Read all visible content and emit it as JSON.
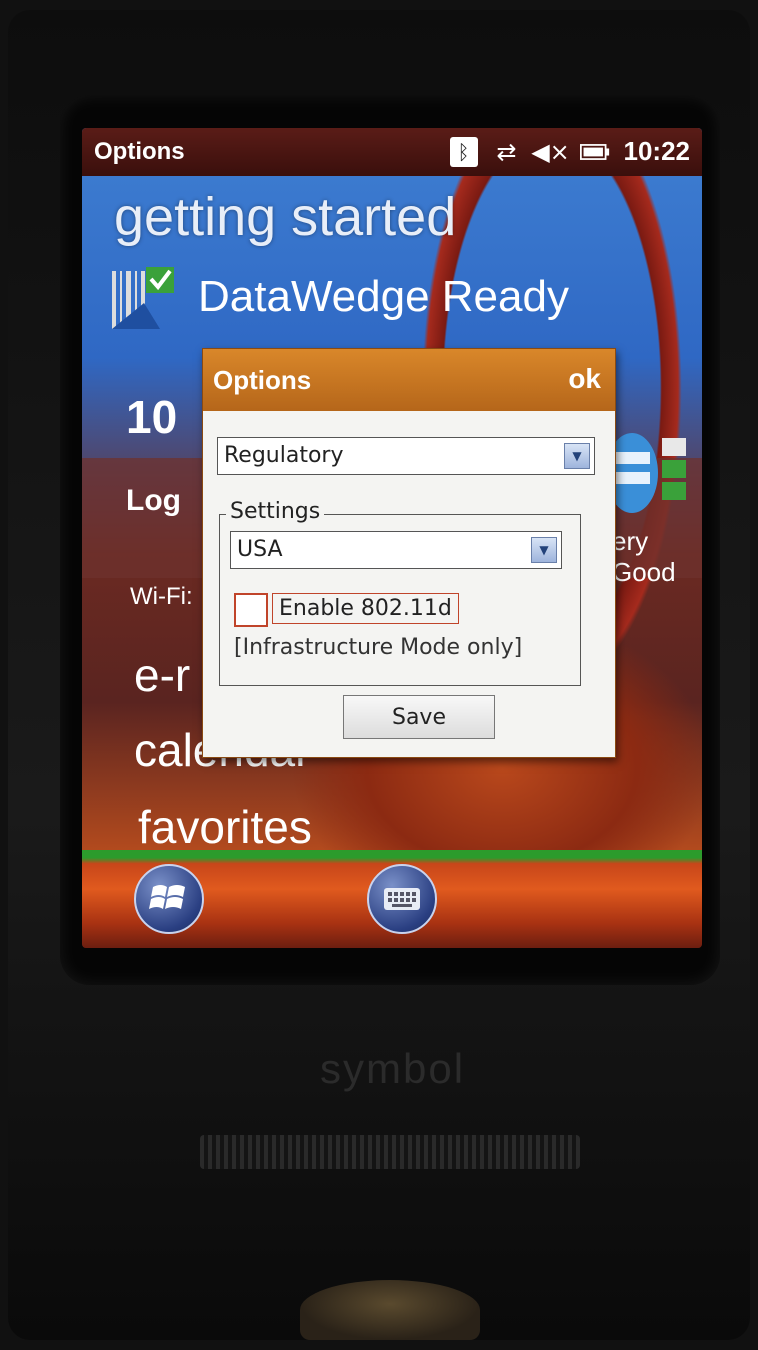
{
  "status_bar": {
    "title": "Options",
    "icons": [
      "bluetooth-icon",
      "network-sync-icon",
      "volume-muted-icon",
      "battery-icon"
    ],
    "time": "10:22"
  },
  "home_screen": {
    "getting_started": "getting started",
    "datawedge": "DataWedge Ready",
    "time_partial": "10",
    "log_partial": "Log",
    "battery_text": "ery Good",
    "wifi_partial": "Wi-Fi:",
    "email_partial": "e-r",
    "calendar": "calendar",
    "favorites": "favorites"
  },
  "dialog": {
    "title": "Options",
    "ok_label": "ok",
    "category_select": "Regulatory",
    "group_label": "Settings",
    "country_select": "USA",
    "checkbox_label": "Enable 802.11d",
    "checkbox_checked": false,
    "note": "[Infrastructure Mode only]",
    "save_label": "Save"
  },
  "device": {
    "brand": "symbol"
  },
  "colors": {
    "dialog_header": "#c97a22",
    "status_bar": "#4a1612",
    "checkbox_border": "#c0442a"
  }
}
